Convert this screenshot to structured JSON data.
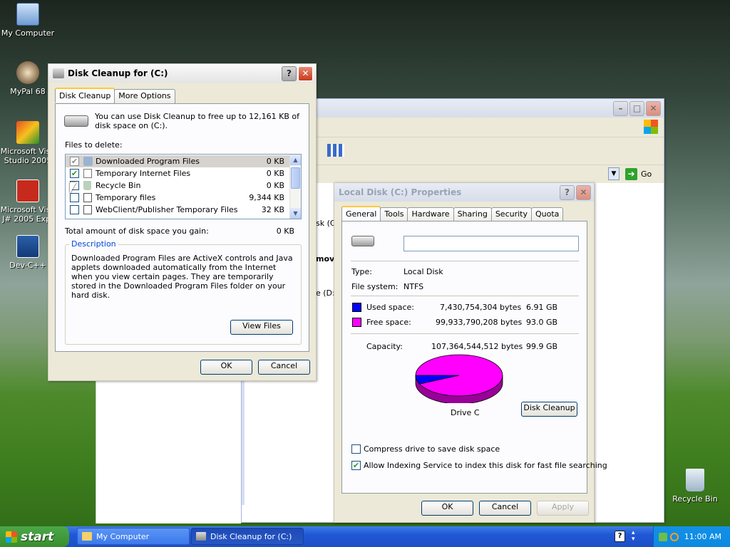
{
  "desktop": {
    "icons": [
      {
        "label": "My Computer"
      },
      {
        "label": "MyPal 68"
      },
      {
        "label": "Microsoft Visu Studio 2005"
      },
      {
        "label": "Microsoft Visu J# 2005 Exp."
      },
      {
        "label": "Dev-C++"
      },
      {
        "label": "Recycle Bin"
      }
    ]
  },
  "background_window": {
    "address_go": "Go",
    "fragments": [
      "sk (C",
      "mov",
      "e (D:"
    ]
  },
  "disk_cleanup": {
    "title": "Disk Cleanup for  (C:)",
    "tabs": [
      "Disk Cleanup",
      "More Options"
    ],
    "intro": "You can use Disk Cleanup to free up to 12,161 KB of disk space on  (C:).",
    "files_label": "Files to delete:",
    "files": [
      {
        "checked": true,
        "name": "Downloaded Program Files",
        "size": "0 KB"
      },
      {
        "checked": true,
        "name": "Temporary Internet Files",
        "size": "0 KB"
      },
      {
        "checked": false,
        "name": "Recycle Bin",
        "size": "0 KB"
      },
      {
        "checked": false,
        "name": "Temporary files",
        "size": "9,344 KB"
      },
      {
        "checked": false,
        "name": "WebClient/Publisher Temporary Files",
        "size": "32 KB"
      }
    ],
    "total_label": "Total amount of disk space you gain:",
    "total_value": "0 KB",
    "description_label": "Description",
    "description": "Downloaded Program Files are ActiveX controls and Java applets downloaded automatically from the Internet when you view certain pages. They are temporarily stored in the Downloaded Program Files folder on your hard disk.",
    "view_files": "View Files",
    "ok": "OK",
    "cancel": "Cancel"
  },
  "properties": {
    "title": "Local Disk (C:) Properties",
    "tabs": [
      "General",
      "Tools",
      "Hardware",
      "Sharing",
      "Security",
      "Quota"
    ],
    "volume_label": "",
    "type_label": "Type:",
    "type_value": "Local Disk",
    "fs_label": "File system:",
    "fs_value": "NTFS",
    "used_label": "Used space:",
    "used_bytes": "7,430,754,304 bytes",
    "used_gb": "6.91 GB",
    "free_label": "Free space:",
    "free_bytes": "99,933,790,208 bytes",
    "free_gb": "93.0 GB",
    "cap_label": "Capacity:",
    "cap_bytes": "107,364,544,512 bytes",
    "cap_gb": "99.9 GB",
    "used_color": "#0000ff",
    "free_color": "#ff00ff",
    "used_fraction": 0.069,
    "drive_label": "Drive C",
    "disk_cleanup": "Disk Cleanup",
    "compress": "Compress drive to save disk space",
    "compress_checked": false,
    "indexing": "Allow Indexing Service to index this disk for fast file searching",
    "indexing_checked": true,
    "ok": "OK",
    "cancel": "Cancel",
    "apply": "Apply"
  },
  "taskbar": {
    "start": "start",
    "items": [
      "My Computer",
      "Disk Cleanup for  (C:)"
    ],
    "clock": "11:00 AM"
  }
}
